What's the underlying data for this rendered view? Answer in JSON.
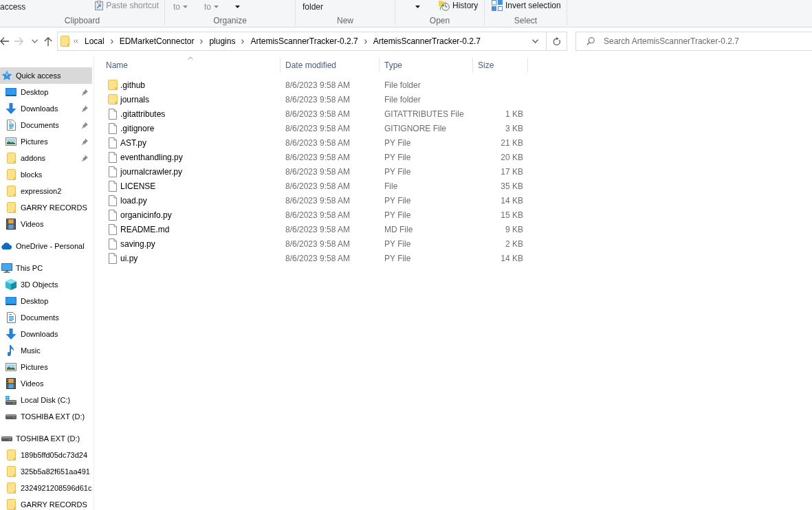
{
  "ribbon": {
    "groups": [
      {
        "label": "Clipboard",
        "items": [
          {
            "kind": "big",
            "label": "access",
            "dropdown": false,
            "disabled": false
          },
          {
            "kind": "paste",
            "label": "Paste shortcut",
            "disabled": true
          }
        ]
      },
      {
        "label": "Organize",
        "items": [
          {
            "kind": "big",
            "label": "to",
            "dropdown": true,
            "disabled": true
          },
          {
            "kind": "big",
            "label": "to",
            "dropdown": true,
            "disabled": true
          },
          {
            "kind": "big",
            "dropdown": true,
            "disabled": false
          }
        ]
      },
      {
        "label": "New",
        "items": [
          {
            "kind": "big",
            "label": "folder",
            "dropdown": false,
            "disabled": false
          }
        ]
      },
      {
        "label": "Open",
        "items": [
          {
            "kind": "big",
            "dropdown": true,
            "disabled": false
          },
          {
            "kind": "history",
            "label": "History",
            "disabled": false
          }
        ]
      },
      {
        "label": "Select",
        "items": [
          {
            "kind": "invert",
            "label": "Invert selection",
            "disabled": false
          }
        ]
      }
    ]
  },
  "navigation": {
    "buttons": [
      {
        "kind": "back",
        "disabled": false
      },
      {
        "kind": "forward",
        "disabled": true
      },
      {
        "kind": "recent",
        "disabled": false
      },
      {
        "kind": "up",
        "disabled": false
      }
    ]
  },
  "address": {
    "breadcrumbs": [
      "Local",
      "EDMarketConnector",
      "plugins",
      "ArtemisScannerTracker-0.2.7",
      "ArtemisScannerTracker-0.2.7"
    ]
  },
  "search": {
    "placeholder": "Search ArtemisScannerTracker-0.2.7"
  },
  "sidebar": {
    "items": [
      {
        "label": "Quick access",
        "kind": "quick",
        "selected": true,
        "children": [
          {
            "label": "Desktop",
            "kind": "desktop",
            "selected": false,
            "pinned": true
          },
          {
            "label": "Downloads",
            "kind": "downloads",
            "selected": false,
            "pinned": true
          },
          {
            "label": "Documents",
            "kind": "documents",
            "selected": false,
            "pinned": true
          },
          {
            "label": "Pictures",
            "kind": "pictures",
            "selected": false,
            "pinned": true
          },
          {
            "label": "addons",
            "kind": "folder",
            "selected": false,
            "pinned": true
          },
          {
            "label": "blocks",
            "kind": "folder",
            "selected": false,
            "pinned": false
          },
          {
            "label": "expression2",
            "kind": "folder",
            "selected": false,
            "pinned": false
          },
          {
            "label": "GARRY RECORDS",
            "kind": "folder",
            "selected": false,
            "pinned": false
          },
          {
            "label": "Videos",
            "kind": "videos",
            "selected": false,
            "pinned": false
          }
        ]
      },
      {
        "label": "OneDrive - Personal",
        "kind": "onedrive",
        "selected": false
      },
      {
        "label": "This PC",
        "kind": "pc",
        "selected": false,
        "children": [
          {
            "label": "3D Objects",
            "kind": "objects",
            "selected": false
          },
          {
            "label": "Desktop",
            "kind": "desktop",
            "selected": false
          },
          {
            "label": "Documents",
            "kind": "documents",
            "selected": false
          },
          {
            "label": "Downloads",
            "kind": "downloads",
            "selected": false
          },
          {
            "label": "Music",
            "kind": "music",
            "selected": false
          },
          {
            "label": "Pictures",
            "kind": "pictures",
            "selected": false
          },
          {
            "label": "Videos",
            "kind": "videos",
            "selected": false
          },
          {
            "label": "Local Disk (C:)",
            "kind": "sysdisk",
            "selected": false
          },
          {
            "label": "TOSHIBA EXT (D:)",
            "kind": "drive",
            "selected": false
          }
        ]
      },
      {
        "label": "TOSHIBA EXT (D:)",
        "kind": "drive",
        "selected": false,
        "children": [
          {
            "label": "189b5ffd05dc73d24",
            "kind": "folder",
            "selected": false
          },
          {
            "label": "325b5a82f651aa491",
            "kind": "folder",
            "selected": false
          },
          {
            "label": "2324921208596d61c",
            "kind": "folder",
            "selected": false
          },
          {
            "label": "GARRY RECORDS",
            "kind": "folder",
            "selected": false
          }
        ]
      }
    ]
  },
  "files": {
    "columns": [
      {
        "label": "Name",
        "sorted": true
      },
      {
        "label": "Date modified",
        "sorted": false
      },
      {
        "label": "Type",
        "sorted": false
      },
      {
        "label": "Size",
        "sorted": false
      }
    ],
    "rows": [
      {
        "kind": "folder",
        "name": ".github",
        "date": "8/6/2023 9:58 AM",
        "type": "File folder"
      },
      {
        "kind": "folder",
        "name": "journals",
        "date": "8/6/2023 9:58 AM",
        "type": "File folder"
      },
      {
        "kind": "file",
        "name": ".gitattributes",
        "date": "8/6/2023 9:58 AM",
        "type": "GITATTRIBUTES File",
        "size": "1 KB"
      },
      {
        "kind": "file",
        "name": ".gitignore",
        "date": "8/6/2023 9:58 AM",
        "type": "GITIGNORE File",
        "size": "3 KB"
      },
      {
        "kind": "file",
        "name": "AST.py",
        "date": "8/6/2023 9:58 AM",
        "type": "PY File",
        "size": "21 KB"
      },
      {
        "kind": "file",
        "name": "eventhandling.py",
        "date": "8/6/2023 9:58 AM",
        "type": "PY File",
        "size": "20 KB"
      },
      {
        "kind": "file",
        "name": "journalcrawler.py",
        "date": "8/6/2023 9:58 AM",
        "type": "PY File",
        "size": "17 KB"
      },
      {
        "kind": "file",
        "name": "LICENSE",
        "date": "8/6/2023 9:58 AM",
        "type": "File",
        "size": "35 KB"
      },
      {
        "kind": "file",
        "name": "load.py",
        "date": "8/6/2023 9:58 AM",
        "type": "PY File",
        "size": "14 KB"
      },
      {
        "kind": "file",
        "name": "organicinfo.py",
        "date": "8/6/2023 9:58 AM",
        "type": "PY File",
        "size": "15 KB"
      },
      {
        "kind": "file",
        "name": "README.md",
        "date": "8/6/2023 9:58 AM",
        "type": "MD File",
        "size": "9 KB"
      },
      {
        "kind": "file",
        "name": "saving.py",
        "date": "8/6/2023 9:58 AM",
        "type": "PY File",
        "size": "2 KB"
      },
      {
        "kind": "file",
        "name": "ui.py",
        "date": "8/6/2023 9:58 AM",
        "type": "PY File",
        "size": "14 KB"
      }
    ]
  }
}
